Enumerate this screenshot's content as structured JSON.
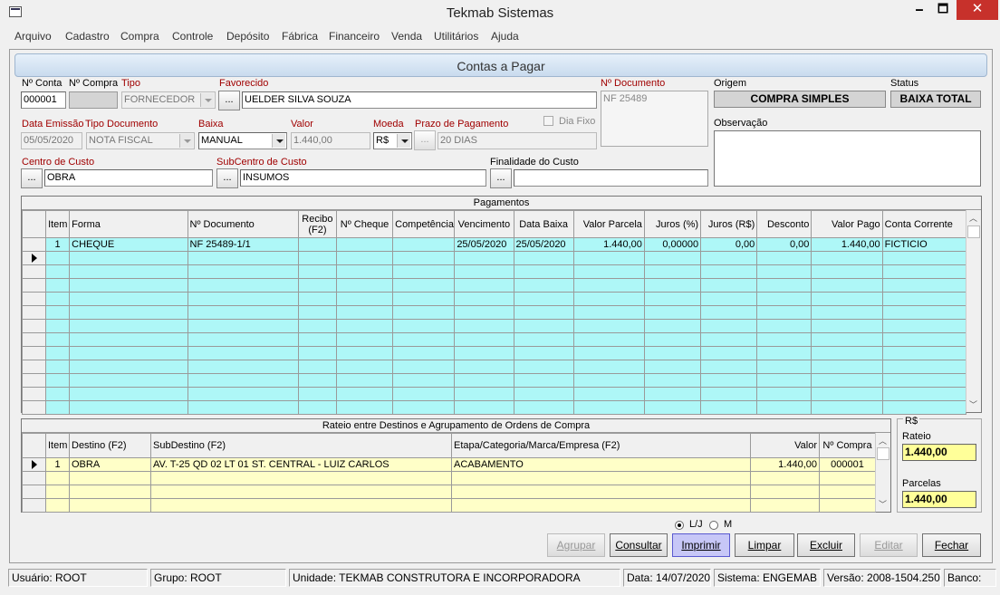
{
  "window": {
    "title": "Tekmab Sistemas",
    "min": "🗕",
    "max": "🗖",
    "close": "✕"
  },
  "menu": [
    "Arquivo",
    "Cadastro",
    "Compra",
    "Controle",
    "Depósito",
    "Fábrica",
    "Financeiro",
    "Venda",
    "Utilitários",
    "Ajuda"
  ],
  "form": {
    "title": "Contas a Pagar",
    "conta": {
      "label": "Nº Conta",
      "value": "000001"
    },
    "compra": {
      "label": "Nº Compra",
      "value": ""
    },
    "tipo": {
      "label": "Tipo",
      "value": "FORNECEDOR"
    },
    "favorecido": {
      "label": "Favorecido",
      "value": "UELDER SILVA SOUZA"
    },
    "documento": {
      "label": "Nº Documento",
      "value": "NF 25489"
    },
    "origem": {
      "label": "Origem",
      "value": "COMPRA SIMPLES"
    },
    "status": {
      "label": "Status",
      "value": "BAIXA TOTAL"
    },
    "data_emissao": {
      "label": "Data Emissão",
      "value": "05/05/2020"
    },
    "tipo_documento": {
      "label": "Tipo Documento",
      "value": "NOTA FISCAL"
    },
    "baixa": {
      "label": "Baixa",
      "value": "MANUAL"
    },
    "valor": {
      "label": "Valor",
      "value": "1.440,00"
    },
    "moeda": {
      "label": "Moeda",
      "value": "R$"
    },
    "prazo": {
      "label": "Prazo de Pagamento",
      "value": "20 DIAS"
    },
    "dia_fixo": {
      "label": "Dia Fixo",
      "checked": false
    },
    "observacao": {
      "label": "Observação",
      "value": ""
    },
    "centro_custo": {
      "label": "Centro de Custo",
      "value": "OBRA"
    },
    "subcentro_custo": {
      "label": "SubCentro de Custo",
      "value": "INSUMOS"
    },
    "finalidade": {
      "label": "Finalidade do Custo",
      "value": ""
    },
    "ellipsis": "..."
  },
  "pagamentos": {
    "caption": "Pagamentos",
    "columns": [
      "Item",
      "Forma",
      "Nº Documento",
      "Recibo (F2)",
      "Nº Cheque",
      "Competência",
      "Vencimento",
      "Data Baixa",
      "Valor Parcela",
      "Juros (%)",
      "Juros (R$)",
      "Desconto",
      "Valor Pago",
      "Conta Corrente"
    ],
    "rows": [
      [
        "1",
        "CHEQUE",
        "NF 25489-1/1",
        "",
        "",
        "",
        "25/05/2020",
        "25/05/2020",
        "1.440,00",
        "0,00000",
        "0,00",
        "0,00",
        "1.440,00",
        "FICTICIO"
      ]
    ]
  },
  "rateio": {
    "caption": "Rateio entre Destinos e Agrupamento de Ordens de Compra",
    "columns": [
      "Item",
      "Destino (F2)",
      "SubDestino (F2)",
      "Etapa/Categoria/Marca/Empresa (F2)",
      "Valor",
      "Nº Compra"
    ],
    "rows": [
      [
        "1",
        "OBRA",
        "AV. T-25 QD 02 LT 01 ST. CENTRAL - LUIZ CARLOS",
        "ACABAMENTO",
        "1.440,00",
        "000001"
      ]
    ],
    "currency": "R$",
    "rateio_label": "Rateio",
    "rateio_value": "1.440,00",
    "parcelas_label": "Parcelas",
    "parcelas_value": "1.440,00"
  },
  "print_options": {
    "lj": "L/J",
    "m": "M",
    "selected": "L/J"
  },
  "buttons": {
    "agrupar": "Agrupar",
    "consultar": "Consultar",
    "imprimir": "Imprimir",
    "limpar": "Limpar",
    "excluir": "Excluir",
    "editar": "Editar",
    "fechar": "Fechar"
  },
  "statusbar": {
    "usuario": "Usuário: ROOT",
    "grupo": "Grupo: ROOT",
    "unidade": "Unidade: TEKMAB CONSTRUTORA E INCORPORADORA",
    "data": "Data: 14/07/2020",
    "sistema": "Sistema: ENGEMAB",
    "versao": "Versão: 2008-1504.250",
    "banco": "Banco:"
  }
}
